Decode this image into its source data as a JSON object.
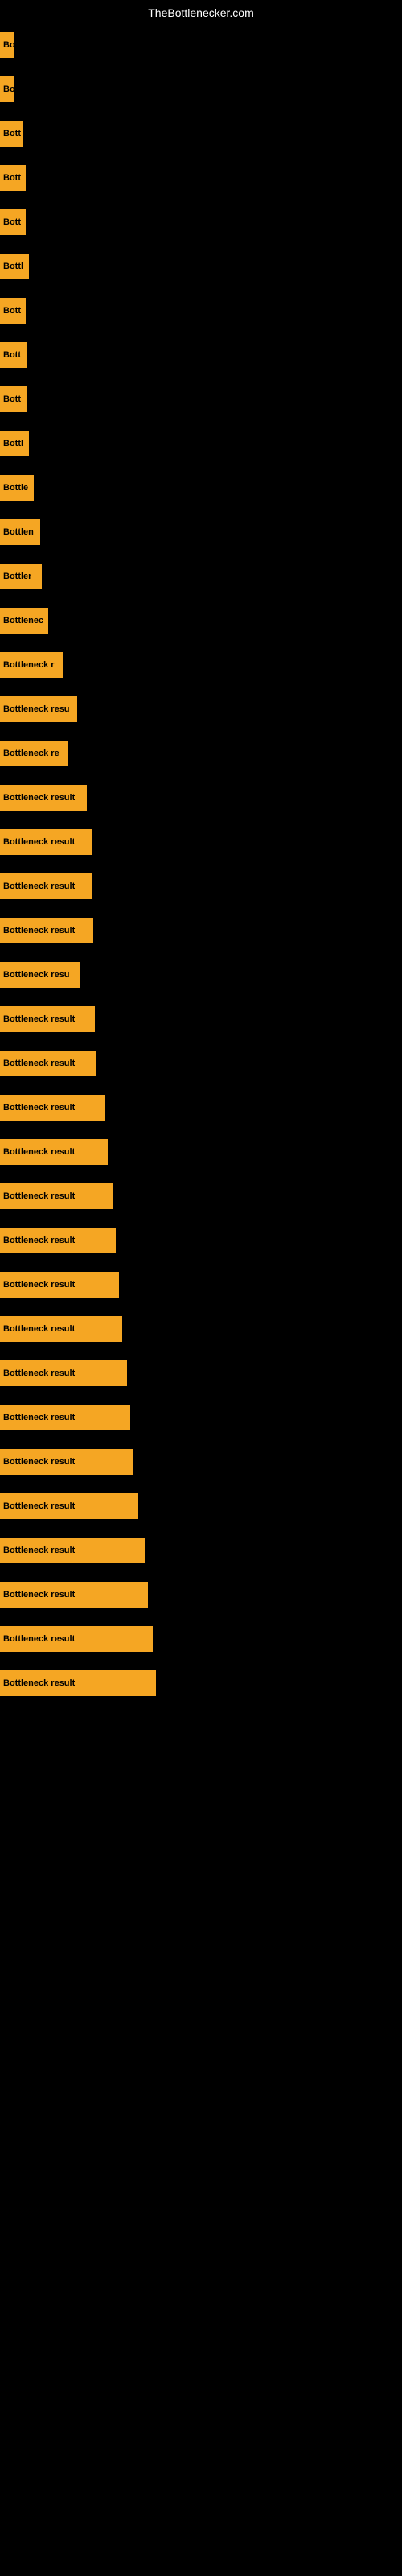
{
  "site": {
    "title": "TheBottlenecker.com"
  },
  "bars": [
    {
      "label": "Bo",
      "width": 18
    },
    {
      "label": "Bo",
      "width": 18
    },
    {
      "label": "Bott",
      "width": 28
    },
    {
      "label": "Bott",
      "width": 32
    },
    {
      "label": "Bott",
      "width": 32
    },
    {
      "label": "Bottl",
      "width": 36
    },
    {
      "label": "Bott",
      "width": 32
    },
    {
      "label": "Bott",
      "width": 34
    },
    {
      "label": "Bott",
      "width": 34
    },
    {
      "label": "Bottl",
      "width": 36
    },
    {
      "label": "Bottle",
      "width": 42
    },
    {
      "label": "Bottlen",
      "width": 50
    },
    {
      "label": "Bottler",
      "width": 52
    },
    {
      "label": "Bottlenec",
      "width": 60
    },
    {
      "label": "Bottleneck r",
      "width": 78
    },
    {
      "label": "Bottleneck resu",
      "width": 96
    },
    {
      "label": "Bottleneck re",
      "width": 84
    },
    {
      "label": "Bottleneck result",
      "width": 108
    },
    {
      "label": "Bottleneck result",
      "width": 114
    },
    {
      "label": "Bottleneck result",
      "width": 114
    },
    {
      "label": "Bottleneck result",
      "width": 116
    },
    {
      "label": "Bottleneck resu",
      "width": 100
    },
    {
      "label": "Bottleneck result",
      "width": 118
    },
    {
      "label": "Bottleneck result",
      "width": 120
    },
    {
      "label": "Bottleneck result",
      "width": 130
    },
    {
      "label": "Bottleneck result",
      "width": 134
    },
    {
      "label": "Bottleneck result",
      "width": 140
    },
    {
      "label": "Bottleneck result",
      "width": 144
    },
    {
      "label": "Bottleneck result",
      "width": 148
    },
    {
      "label": "Bottleneck result",
      "width": 152
    },
    {
      "label": "Bottleneck result",
      "width": 158
    },
    {
      "label": "Bottleneck result",
      "width": 162
    },
    {
      "label": "Bottleneck result",
      "width": 166
    },
    {
      "label": "Bottleneck result",
      "width": 172
    },
    {
      "label": "Bottleneck result",
      "width": 180
    },
    {
      "label": "Bottleneck result",
      "width": 184
    },
    {
      "label": "Bottleneck result",
      "width": 190
    },
    {
      "label": "Bottleneck result",
      "width": 194
    }
  ]
}
